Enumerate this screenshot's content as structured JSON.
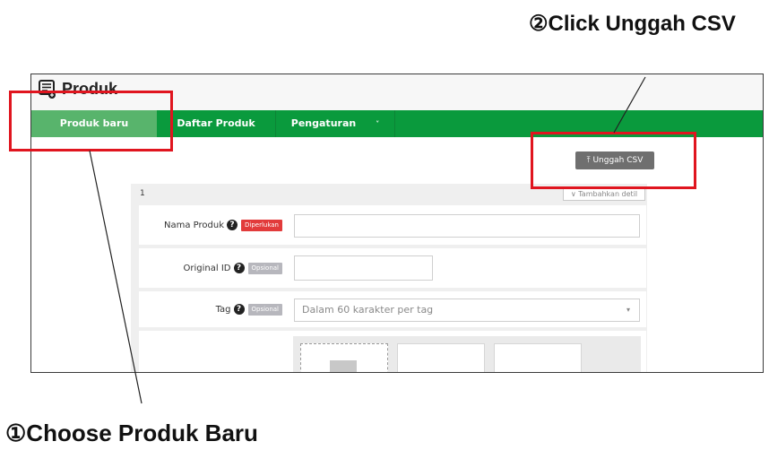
{
  "annotations": {
    "step2": "②Click Unggah CSV",
    "step1": "①Choose Produk Baru"
  },
  "app": {
    "title": "Produk",
    "icon": "product-list-icon"
  },
  "nav": {
    "tabs": [
      {
        "label": "Produk baru",
        "active": true
      },
      {
        "label": "Daftar Produk",
        "active": false
      },
      {
        "label": "Pengaturan",
        "active": false,
        "dropdown": true
      }
    ],
    "dropdown_caret": "˅"
  },
  "toolbar": {
    "upload_icon": "upload-icon",
    "upload_csv_label": "Unggah CSV"
  },
  "form": {
    "card_number": "1",
    "add_detail_label": "∨ Tambahkan detil",
    "fields": [
      {
        "label": "Nama Produk",
        "badge": "Diperlukan",
        "value": "",
        "placeholder": ""
      },
      {
        "label": "Original ID",
        "badge": "Opsional",
        "value": "",
        "placeholder": ""
      },
      {
        "label": "Tag",
        "badge": "Opsional",
        "value": "",
        "placeholder": "Dalam 60 karakter per tag"
      }
    ],
    "help_glyph": "?"
  },
  "colors": {
    "nav_green": "#0a9a3d",
    "active_tab": "#58b46c",
    "highlight_red": "#e0151f",
    "required_badge": "#e23b3b",
    "optional_badge": "#b7b7bd"
  }
}
